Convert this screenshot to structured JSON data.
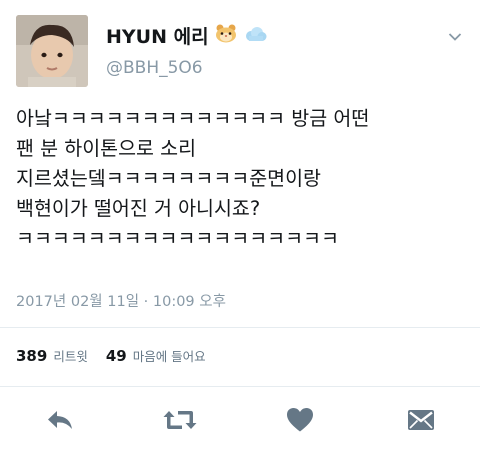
{
  "user": {
    "display_name": "HYUN 에리",
    "emoji_1": "hamster-face",
    "emoji_2": "cloud",
    "handle": "@BBH_5O6"
  },
  "tweet": {
    "lines": [
      "아낰ㅋㅋㅋㅋㅋㅋㅋㅋㅋㅋㅋㅋㅋ 방금 어떤",
      "팬 분 하이톤으로 소리",
      "지르셨는뎈ㅋㅋㅋㅋㅋㅋㅋㅋ준면이랑",
      "백현이가 떨어진 거 아니시죠?",
      "ㅋㅋㅋㅋㅋㅋㅋㅋㅋㅋㅋㅋㅋㅋㅋㅋㅋㅋ"
    ],
    "timestamp": "2017년 02월 11일 · 10:09 오후"
  },
  "stats": {
    "retweet_count": "389",
    "retweet_label": "리트윗",
    "like_count": "49",
    "like_label": "마음에 들어요"
  },
  "actions": [
    "reply-icon",
    "retweet-icon",
    "heart-icon",
    "message-icon"
  ],
  "colors": {
    "text": "#14171a",
    "secondary": "#8899a6",
    "icon": "#657786",
    "divider": "#e6ecf0"
  }
}
